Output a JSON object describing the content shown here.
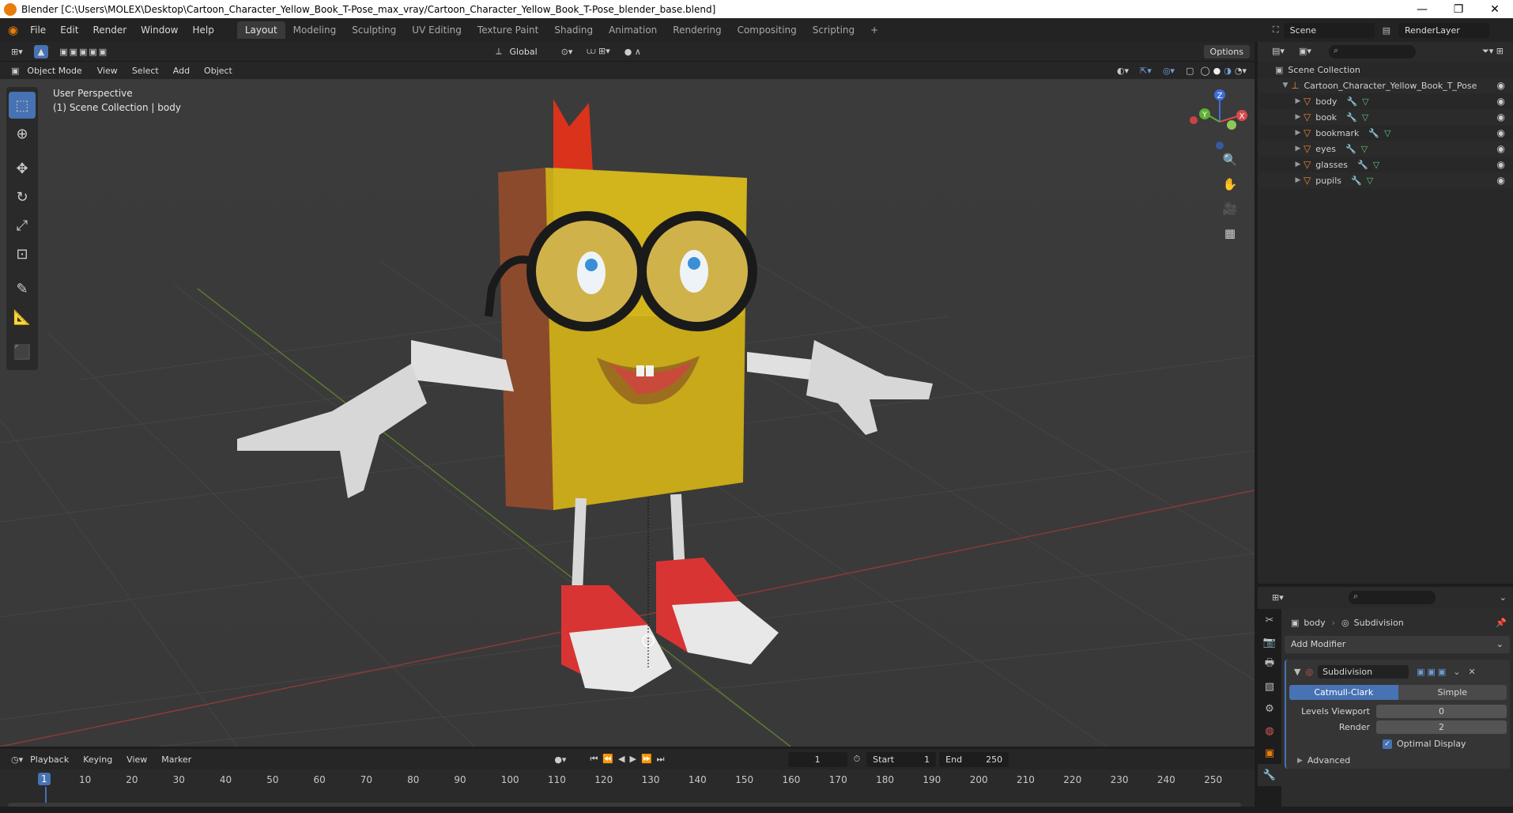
{
  "window": {
    "title": "Blender [C:\\Users\\MOLEX\\Desktop\\Cartoon_Character_Yellow_Book_T-Pose_max_vray/Cartoon_Character_Yellow_Book_T-Pose_blender_base.blend]",
    "min": "—",
    "max": "❐",
    "close": "✕"
  },
  "menus": [
    "File",
    "Edit",
    "Render",
    "Window",
    "Help"
  ],
  "workspaces": [
    "Layout",
    "Modeling",
    "Sculpting",
    "UV Editing",
    "Texture Paint",
    "Shading",
    "Animation",
    "Rendering",
    "Compositing",
    "Scripting"
  ],
  "add_tab": "+",
  "scene": {
    "label": "Scene",
    "renderlayer": "RenderLayer"
  },
  "header3d": {
    "transform": "Global",
    "options": "Options",
    "mode": "Object Mode",
    "menus": [
      "View",
      "Select",
      "Add",
      "Object"
    ]
  },
  "viewport": {
    "perspective": "User Perspective",
    "collection": "(1) Scene Collection | body"
  },
  "gizmo": {
    "z": "Z",
    "y": "Y",
    "x": "X"
  },
  "outliner": {
    "root": "Scene Collection",
    "collection": "Cartoon_Character_Yellow_Book_T_Pose",
    "objects": [
      "body",
      "book",
      "bookmark",
      "eyes",
      "glasses",
      "pupils"
    ]
  },
  "properties": {
    "object": "body",
    "modifier_tab": "Subdivision",
    "add_modifier": "Add Modifier",
    "modifier_name": "Subdivision",
    "catmull": "Catmull-Clark",
    "simple": "Simple",
    "levels_label": "Levels Viewport",
    "levels_value": "0",
    "render_label": "Render",
    "render_value": "2",
    "optimal": "Optimal Display",
    "advanced": "Advanced"
  },
  "timeline": {
    "menus": [
      "Playback",
      "Keying",
      "View",
      "Marker"
    ],
    "current_frame": "1",
    "start_label": "Start",
    "start": "1",
    "end_label": "End",
    "end": "250",
    "ticks": [
      "10",
      "20",
      "30",
      "40",
      "50",
      "60",
      "70",
      "80",
      "90",
      "100",
      "110",
      "120",
      "130",
      "140",
      "150",
      "160",
      "170",
      "180",
      "190",
      "200",
      "210",
      "220",
      "230",
      "240",
      "250"
    ],
    "playhead": "1"
  },
  "colors": {
    "accent": "#4772b3",
    "orange": "#e87d0d"
  }
}
